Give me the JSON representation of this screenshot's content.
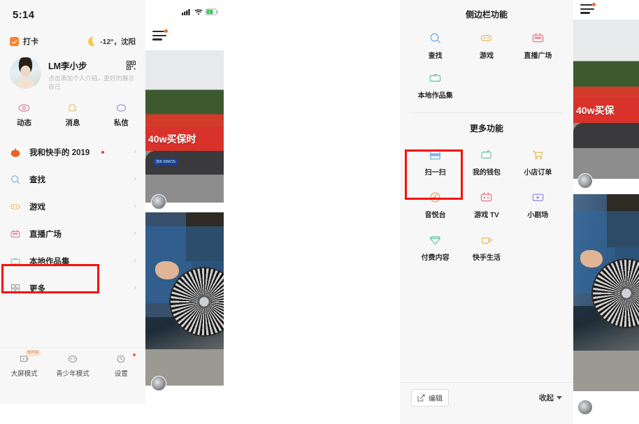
{
  "left_phone": {
    "status_bar": {
      "time": "5:14",
      "signal_icon": "cellular-signal-icon",
      "wifi_icon": "wifi-icon",
      "battery_icon": "battery-charging-icon"
    },
    "check_in": {
      "label": "打卡",
      "icon": "checkbox-checked-icon"
    },
    "weather": {
      "icon": "moon-icon",
      "text": "-12°，沈阳"
    },
    "profile": {
      "avatar": "user-avatar",
      "name": "LM李小步",
      "qr_icon": "qr-code-icon",
      "subtitle": "点击添加个人介绍，更好的展示自己"
    },
    "quick_actions": [
      {
        "label": "动态",
        "icon": "eye-icon"
      },
      {
        "label": "消息",
        "icon": "bell-icon"
      },
      {
        "label": "私信",
        "icon": "chat-bubble-icon"
      }
    ],
    "menu": [
      {
        "label": "我和快手的 2019",
        "icon": "pumpkin-icon",
        "dot": true,
        "chevron": "›"
      },
      {
        "label": "查找",
        "icon": "search-icon",
        "dot": false,
        "chevron": "›"
      },
      {
        "label": "游戏",
        "icon": "game-icon",
        "dot": false,
        "chevron": "›"
      },
      {
        "label": "直播广场",
        "icon": "live-icon",
        "dot": false,
        "chevron": "›"
      },
      {
        "label": "本地作品集",
        "icon": "folder-icon",
        "dot": false,
        "chevron": "›"
      },
      {
        "label": "更多",
        "icon": "grid-icon",
        "dot": false,
        "chevron": "›"
      }
    ],
    "bottom_bar": [
      {
        "label": "大屏模式",
        "icon": "tv-screen-icon",
        "badge": "未开启",
        "dot": false
      },
      {
        "label": "青少年模式",
        "icon": "teen-mode-icon",
        "badge": "",
        "dot": false
      },
      {
        "label": "设置",
        "icon": "settings-gear-icon",
        "badge": "",
        "dot": true
      }
    ],
    "feed": {
      "menu_icon": "hamburger-menu-icon",
      "video_top_caption": "40w买保时",
      "plate_text": "苏B·88W25"
    }
  },
  "right_phone": {
    "sheet": {
      "section1_title": "侧边栏功能",
      "section1_items": [
        {
          "label": "查找",
          "icon": "search-icon"
        },
        {
          "label": "游戏",
          "icon": "game-icon"
        },
        {
          "label": "直播广场",
          "icon": "live-icon"
        },
        {
          "label": "本地作品集",
          "icon": "folder-icon"
        }
      ],
      "section2_title": "更多功能",
      "section2_items": [
        {
          "label": "扫一扫",
          "icon": "scan-icon"
        },
        {
          "label": "我的钱包",
          "icon": "wallet-icon"
        },
        {
          "label": "小店订单",
          "icon": "shopping-cart-icon"
        },
        {
          "label": "音悦台",
          "icon": "music-disc-icon"
        },
        {
          "label": "游戏 TV",
          "icon": "game-tv-icon"
        },
        {
          "label": "小剧场",
          "icon": "theater-screen-icon"
        },
        {
          "label": "付费内容",
          "icon": "diamond-icon"
        },
        {
          "label": "快手生活",
          "icon": "coffee-cup-icon"
        }
      ],
      "edit_button": {
        "label": "编辑",
        "icon": "edit-pencil-icon"
      },
      "collapse_button": {
        "label": "收起",
        "icon": "caret-down-icon"
      }
    },
    "feed": {
      "menu_icon": "hamburger-menu-icon",
      "video_top_caption": "40w买保"
    }
  },
  "annotations": {
    "highlight_color": "#fb1005",
    "boxes": [
      {
        "name": "highlight-more-menu-item"
      },
      {
        "name": "highlight-scan-tile"
      }
    ]
  }
}
